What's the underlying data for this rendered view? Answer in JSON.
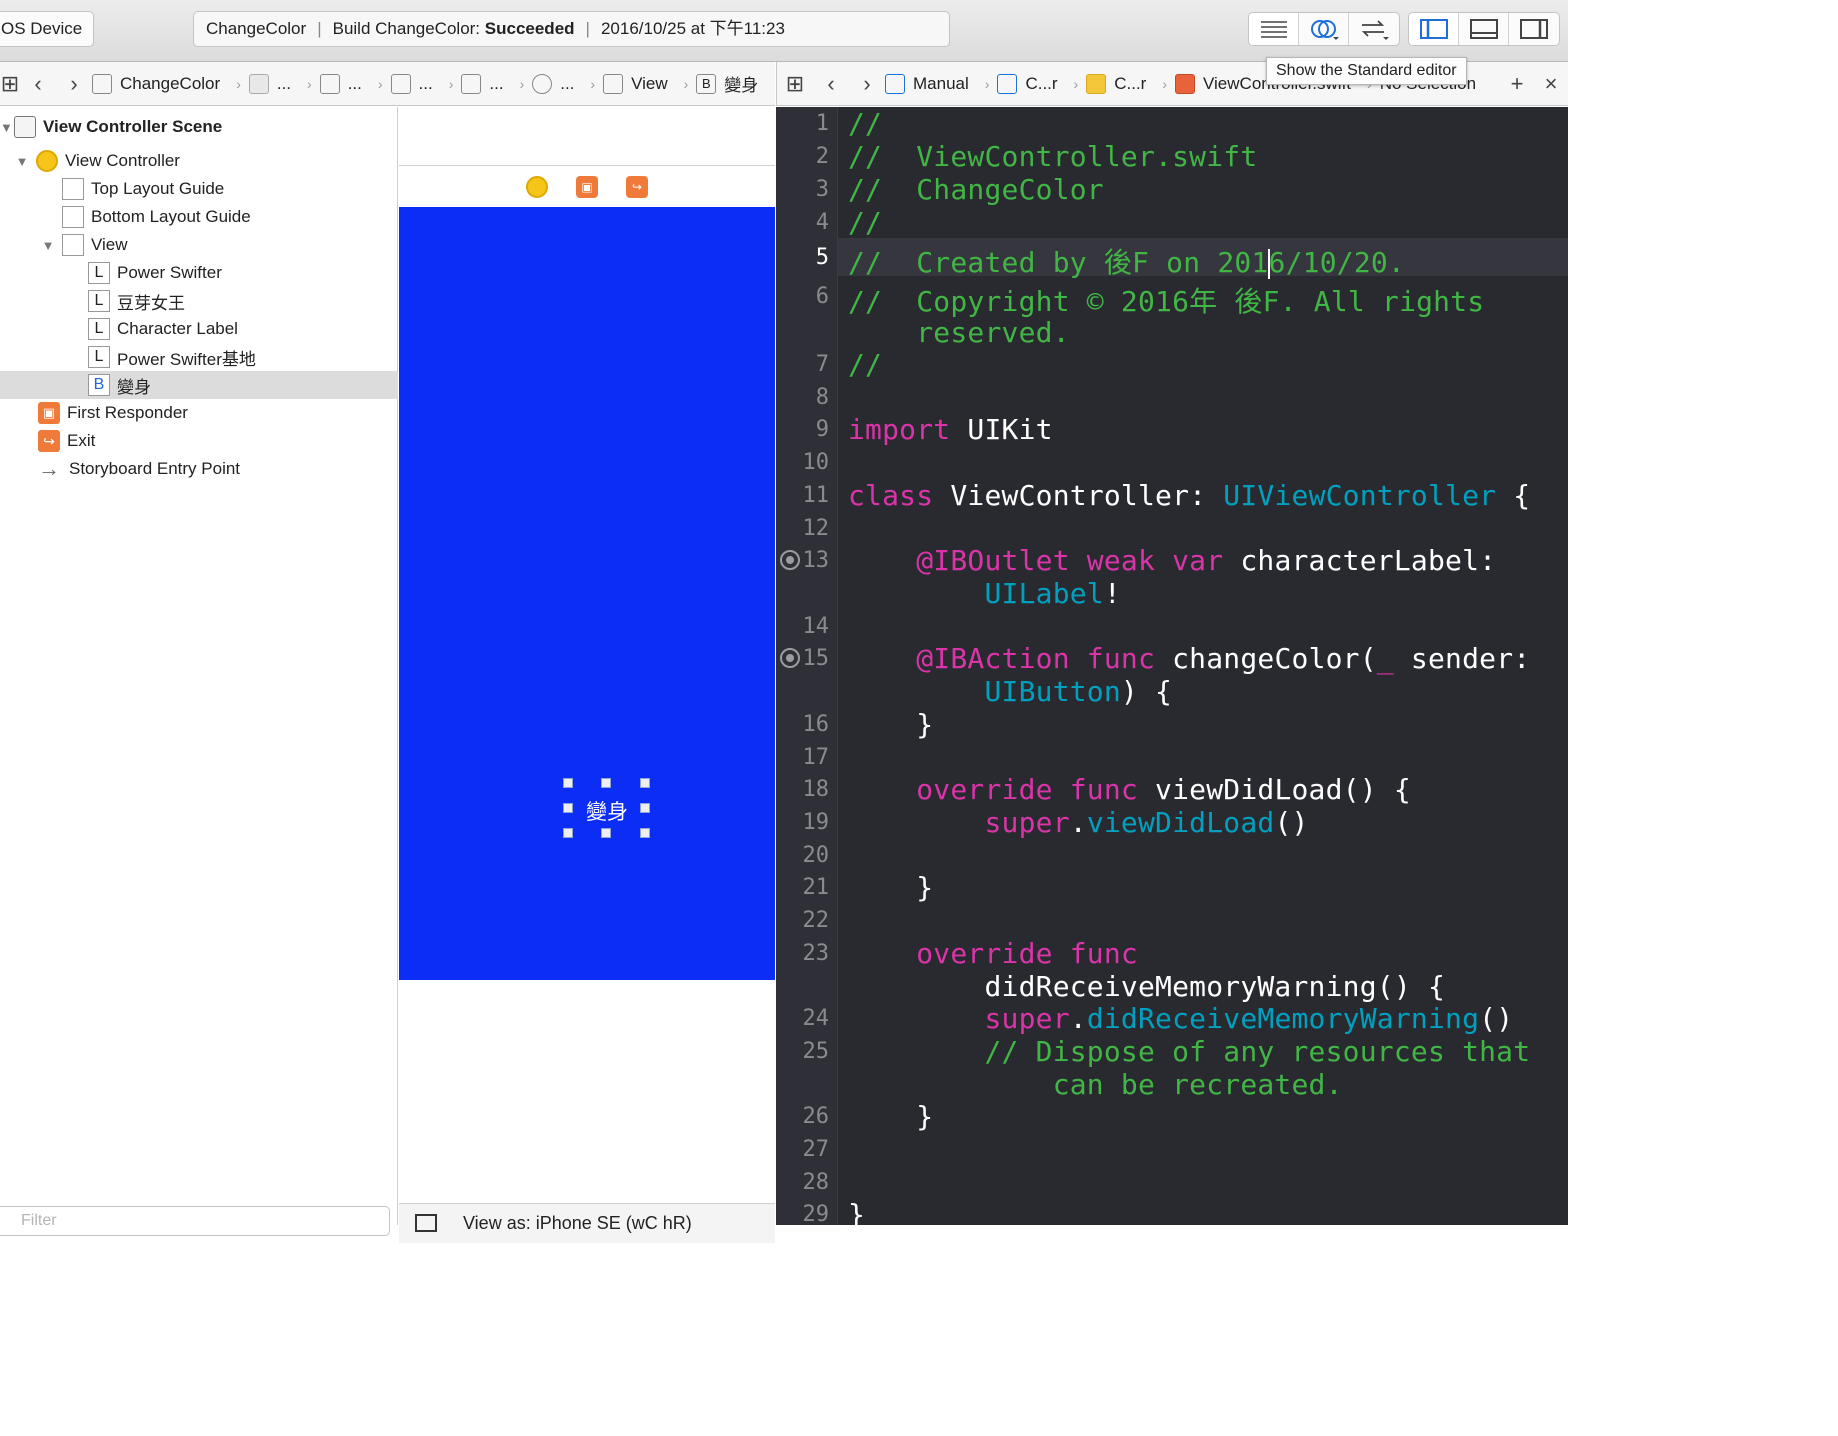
{
  "toolbar": {
    "scheme_label": "OS Device",
    "activity_project": "ChangeColor",
    "activity_build_prefix": "Build ChangeColor:",
    "activity_build_status": "Succeeded",
    "activity_time": "2016/10/25 at 下午11:23"
  },
  "tooltip": "Show the Standard editor",
  "ib_jumpbar": {
    "project": "ChangeColor",
    "ellipsis": "...",
    "view": "View",
    "button": "變身"
  },
  "code_jumpbar": {
    "manual": "Manual",
    "item2": "C...r",
    "item3": "C...r",
    "file": "ViewController.swift",
    "selection": "No Selection"
  },
  "outline": {
    "scene": "View Controller Scene",
    "view_controller": "View Controller",
    "top_guide": "Top Layout Guide",
    "bottom_guide": "Bottom Layout Guide",
    "view": "View",
    "label1": "Power Swifter",
    "label2": "豆芽女王",
    "label3": "Character Label",
    "label4": "Power Swifter基地",
    "button": "變身",
    "first_responder": "First Responder",
    "exit": "Exit",
    "entry_point": "Storyboard Entry Point",
    "label_glyph": "L",
    "button_glyph": "B",
    "filter_placeholder": "Filter"
  },
  "canvas": {
    "button_title": "變身",
    "view_as": "View as: iPhone SE (wC hR)",
    "background_color": "#0c2df5"
  },
  "code": {
    "line_numbers": [
      "1",
      "2",
      "3",
      "4",
      "5",
      "6",
      "7",
      "8",
      "9",
      "10",
      "11",
      "12",
      "13",
      "14",
      "15",
      "16",
      "17",
      "18",
      "19",
      "20",
      "21",
      "22",
      "23",
      "24",
      "25",
      "26",
      "27",
      "28",
      "29"
    ],
    "l1": "//",
    "l2": "//  ViewController.swift",
    "l3": "//  ChangeColor",
    "l4": "//",
    "l5a": "//  Created by 後F on 201",
    "l5b": "6/10/20.",
    "l6a": "//  Copyright © 2016年 後F. All rights",
    "l6b": "    reserved.",
    "l7": "//",
    "l9_kw": "import",
    "l9_rest": " UIKit",
    "l11_kw": "class",
    "l11_mid": " ViewController: ",
    "l11_ty": "UIViewController",
    "l11_end": " {",
    "l13_kw": "    @IBOutlet weak var",
    "l13_rest": " characterLabel:",
    "l13b_ty": "        UILabel",
    "l13b_end": "!",
    "l15_kw": "    @IBAction func",
    "l15_rest": " changeColor(",
    "l15_us": "_",
    "l15_end": " sender:",
    "l15b_ty": "        UIButton",
    "l15b_end": ") {",
    "l16": "    }",
    "l18_kw": "    override func",
    "l18_rest": " viewDidLoad() {",
    "l19_kw": "        super",
    "l19_dot": ".",
    "l19_ty": "viewDidLoad",
    "l19_end": "()",
    "l21": "    }",
    "l23_kw": "    override func",
    "l23b": "        didReceiveMemoryWarning() {",
    "l24_kw": "        super",
    "l24_dot": ".",
    "l24_ty": "didReceiveMemoryWarning",
    "l24_end": "()",
    "l25a": "        // Dispose of any resources that",
    "l25b": "            can be recreated.",
    "l26": "    }",
    "l29": "}"
  },
  "colors": {
    "comment": "#41b645",
    "keyword": "#d934a8",
    "type": "#00a0be",
    "editor_bg": "#292a30"
  }
}
